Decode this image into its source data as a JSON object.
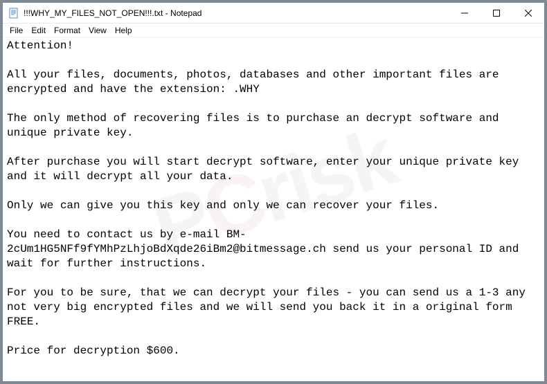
{
  "window": {
    "title": "!!!WHY_MY_FILES_NOT_OPEN!!!.txt - Notepad"
  },
  "menu": {
    "file": "File",
    "edit": "Edit",
    "format": "Format",
    "view": "View",
    "help": "Help"
  },
  "body": {
    "text": "Attention!\n\nAll your files, documents, photos, databases and other important files are encrypted and have the extension: .WHY\n\nThe only method of recovering files is to purchase an decrypt software and unique private key.\n\nAfter purchase you will start decrypt software, enter your unique private key and it will decrypt all your data.\n\nOnly we can give you this key and only we can recover your files.\n\nYou need to contact us by e-mail BM-2cUm1HG5NFf9fYMhPzLhjoBdXqde26iBm2@bitmessage.ch send us your personal ID and wait for further instructions.\n\nFor you to be sure, that we can decrypt your files - you can send us a 1-3 any not very big encrypted files and we will send you back it in a original form FREE.\n\nPrice for decryption $600."
  },
  "watermark": {
    "p": "P",
    "c": "C",
    "r": "risk"
  }
}
